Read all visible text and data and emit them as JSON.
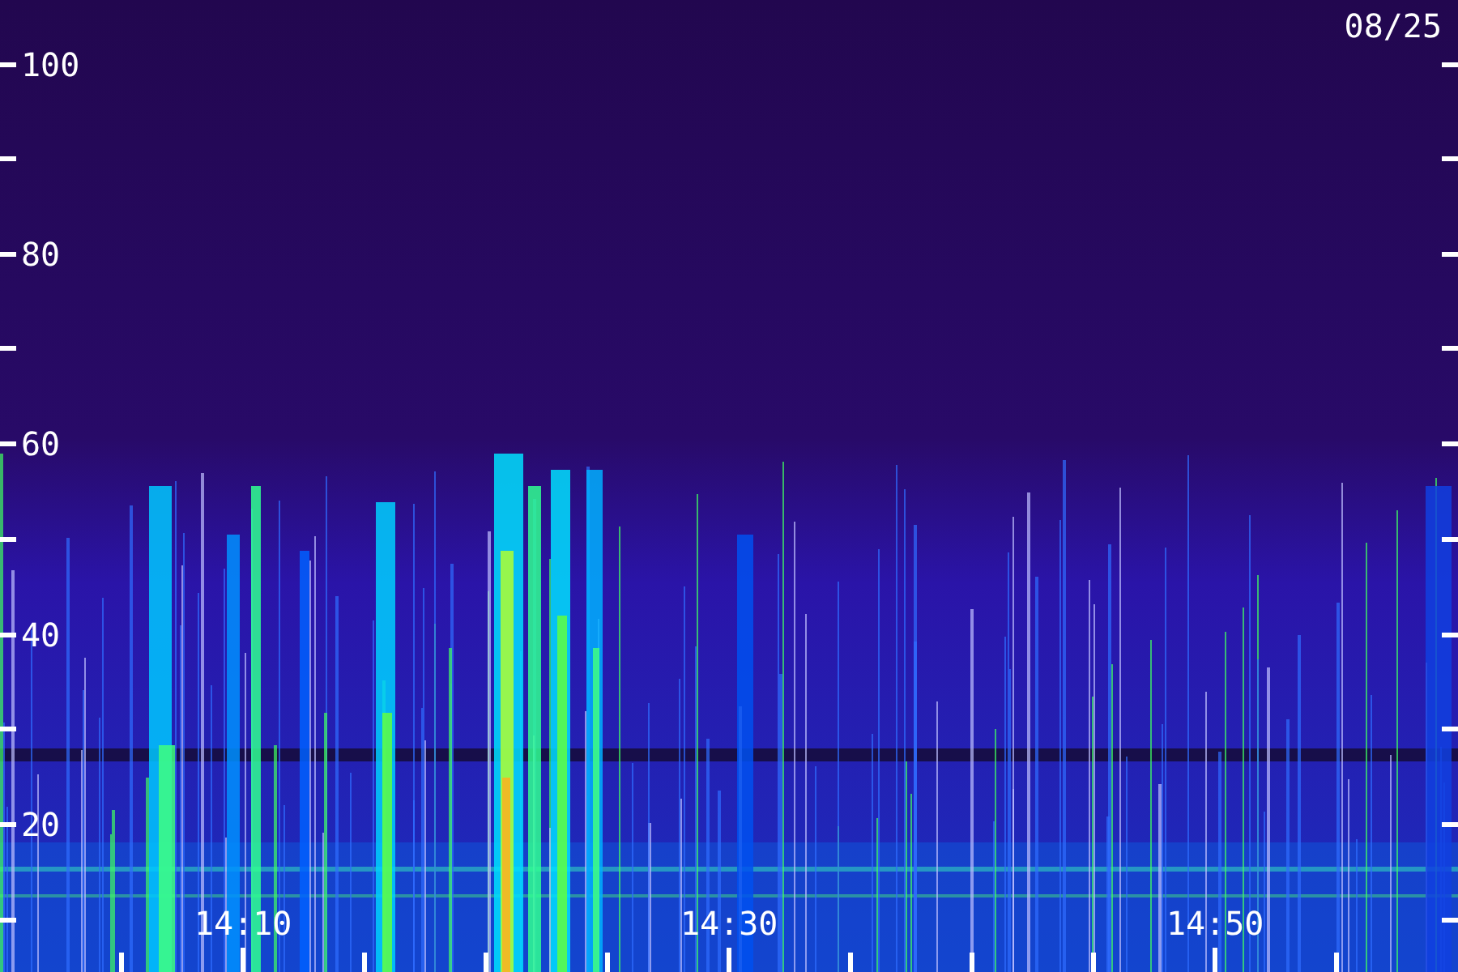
{
  "date": "08/25",
  "y_axis": {
    "ticks": [
      "100",
      "80",
      "60",
      "40",
      "20"
    ]
  },
  "x_axis": {
    "ticks": [
      "14:10",
      "14:30",
      "14:50"
    ]
  }
}
